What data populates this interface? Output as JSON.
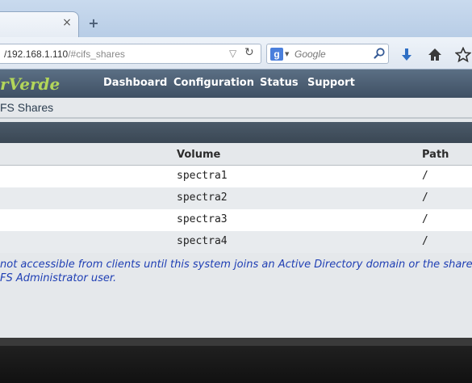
{
  "browser": {
    "tab_close_glyph": "×",
    "tab_new_glyph": "+",
    "url_host": "/192.168.1.110",
    "url_path": "/#cifs_shares",
    "search_engine_letter": "g",
    "search_placeholder": "Google"
  },
  "app": {
    "logo_text": "rVerde",
    "logo_color": "#b3d65a",
    "menu": [
      "Dashboard",
      "Configuration",
      "Status",
      "Support"
    ]
  },
  "page": {
    "breadcrumb": "FS Shares",
    "columns": {
      "volume": "Volume",
      "path": "Path"
    },
    "rows": [
      {
        "volume": "spectra1",
        "path": "/"
      },
      {
        "volume": "spectra2",
        "path": "/"
      },
      {
        "volume": "spectra3",
        "path": "/"
      },
      {
        "volume": "spectra4",
        "path": "/"
      }
    ],
    "note_line1": "not accessible from clients until this system joins an Active Directory domain or the shares c",
    "note_line2": "FS Administrator user."
  }
}
